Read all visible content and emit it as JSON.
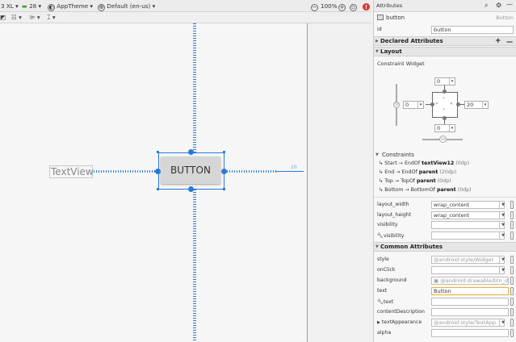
{
  "toolbar": {
    "device": "3 XL",
    "api": "28",
    "theme": "AppTheme",
    "locale": "Default (en-us)",
    "zoom": "100%",
    "zoom_out": "−",
    "zoom_in": "+",
    "error_badge": "!"
  },
  "canvas": {
    "textview_label": "TextView",
    "button_label": "BUTTON",
    "margin_label": "20"
  },
  "panel": {
    "title": "Attributes",
    "component_name": "button",
    "component_type": "Button",
    "id_label": "id",
    "id_value": "button",
    "declared_title": "Declared Attributes",
    "declared_add": "+",
    "declared_remove": "—",
    "layout_title": "Layout",
    "constraint_widget_title": "Constraint Widget",
    "widget": {
      "top_margin": "0",
      "left_margin": "0",
      "right_margin": "20",
      "bottom_margin": "0",
      "h_bias": "50",
      "v_bias": "50"
    },
    "constraints_title": "Constraints",
    "constraints": [
      {
        "prefix": "Start → EndOf",
        "target": "textView12",
        "margin": "(0dp)"
      },
      {
        "prefix": "End → EndOf",
        "target": "parent",
        "margin": "(20dp)"
      },
      {
        "prefix": "Top → TopOf",
        "target": "parent",
        "margin": "(0dp)"
      },
      {
        "prefix": "Bottom → BottomOf",
        "target": "parent",
        "margin": "(0dp)"
      }
    ],
    "layout_attrs": [
      {
        "label": "layout_width",
        "value": "wrap_content"
      },
      {
        "label": "layout_height",
        "value": "wrap_content"
      },
      {
        "label": "visibility",
        "value": ""
      },
      {
        "label": "visibility",
        "value": ""
      }
    ],
    "common_title": "Common Attributes",
    "common_attrs": [
      {
        "label": "style",
        "value": "@android:style/Widget"
      },
      {
        "label": "onClick",
        "value": ""
      },
      {
        "label": "background",
        "value": "@android:drawable/btn_d"
      },
      {
        "label": "text",
        "value": "Button"
      },
      {
        "label": "text",
        "value": ""
      },
      {
        "label": "contentDescription",
        "value": ""
      },
      {
        "label": "textAppearance",
        "value": "@android:style/TextApp"
      },
      {
        "label": "alpha",
        "value": ""
      }
    ]
  },
  "colors": {
    "accent": "#2a7ad5",
    "text_highlight": "#f0b030",
    "error": "#d9342b"
  }
}
